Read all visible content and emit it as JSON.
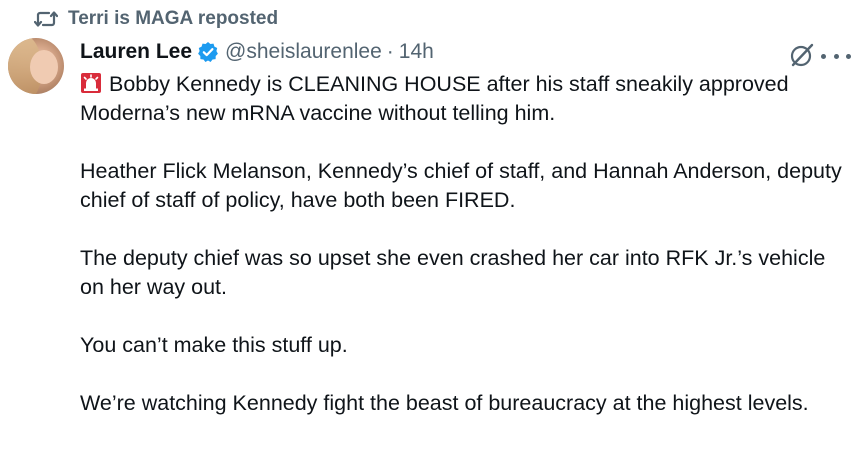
{
  "repost": {
    "label": "Terri is MAGA reposted",
    "icon": "repost-icon"
  },
  "author": {
    "name": "Lauren Lee",
    "verified": true,
    "handle": "@sheislaurenlee",
    "separator": "·",
    "time": "14h"
  },
  "actions": {
    "grok_icon": "grok-icon",
    "more_icon": "more-icon"
  },
  "tweet": {
    "emoji": "siren-icon",
    "paragraphs": [
      "Bobby Kennedy is CLEANING HOUSE after his staff sneakily approved Moderna’s new mRNA vaccine without telling him.",
      "Heather Flick Melanson, Kennedy’s chief of staff, and Hannah Anderson, deputy chief of staff of policy, have both been FIRED.",
      "The deputy chief was so upset she even crashed her car into RFK Jr.’s vehicle on her way out.",
      "You can’t make this stuff up.",
      "We’re watching Kennedy fight the beast of bureaucracy at the highest levels."
    ]
  },
  "colors": {
    "text": "#0f1419",
    "secondary": "#536471",
    "verified_blue": "#1d9bf0",
    "siren_red": "#e0245e"
  }
}
